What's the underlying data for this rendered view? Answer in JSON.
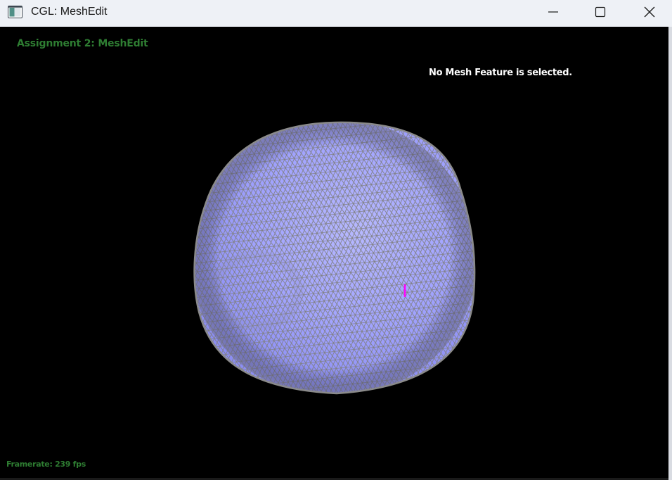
{
  "window": {
    "title": "CGL: MeshEdit",
    "icon": "app-window-icon"
  },
  "controls": {
    "minimize_icon": "minimize-icon",
    "maximize_icon": "maximize-icon",
    "close_icon": "close-icon"
  },
  "overlay": {
    "assignment_title": "Assignment 2: MeshEdit",
    "feature_status": "No Mesh Feature is selected.",
    "framerate": "Framerate: 239 fps"
  },
  "colors": {
    "mesh_fill": "#a4a6ff",
    "mesh_wire": "#7f7f7f",
    "highlight": "#ff00ff",
    "overlay_green": "#2e7d32",
    "background": "#000000"
  }
}
